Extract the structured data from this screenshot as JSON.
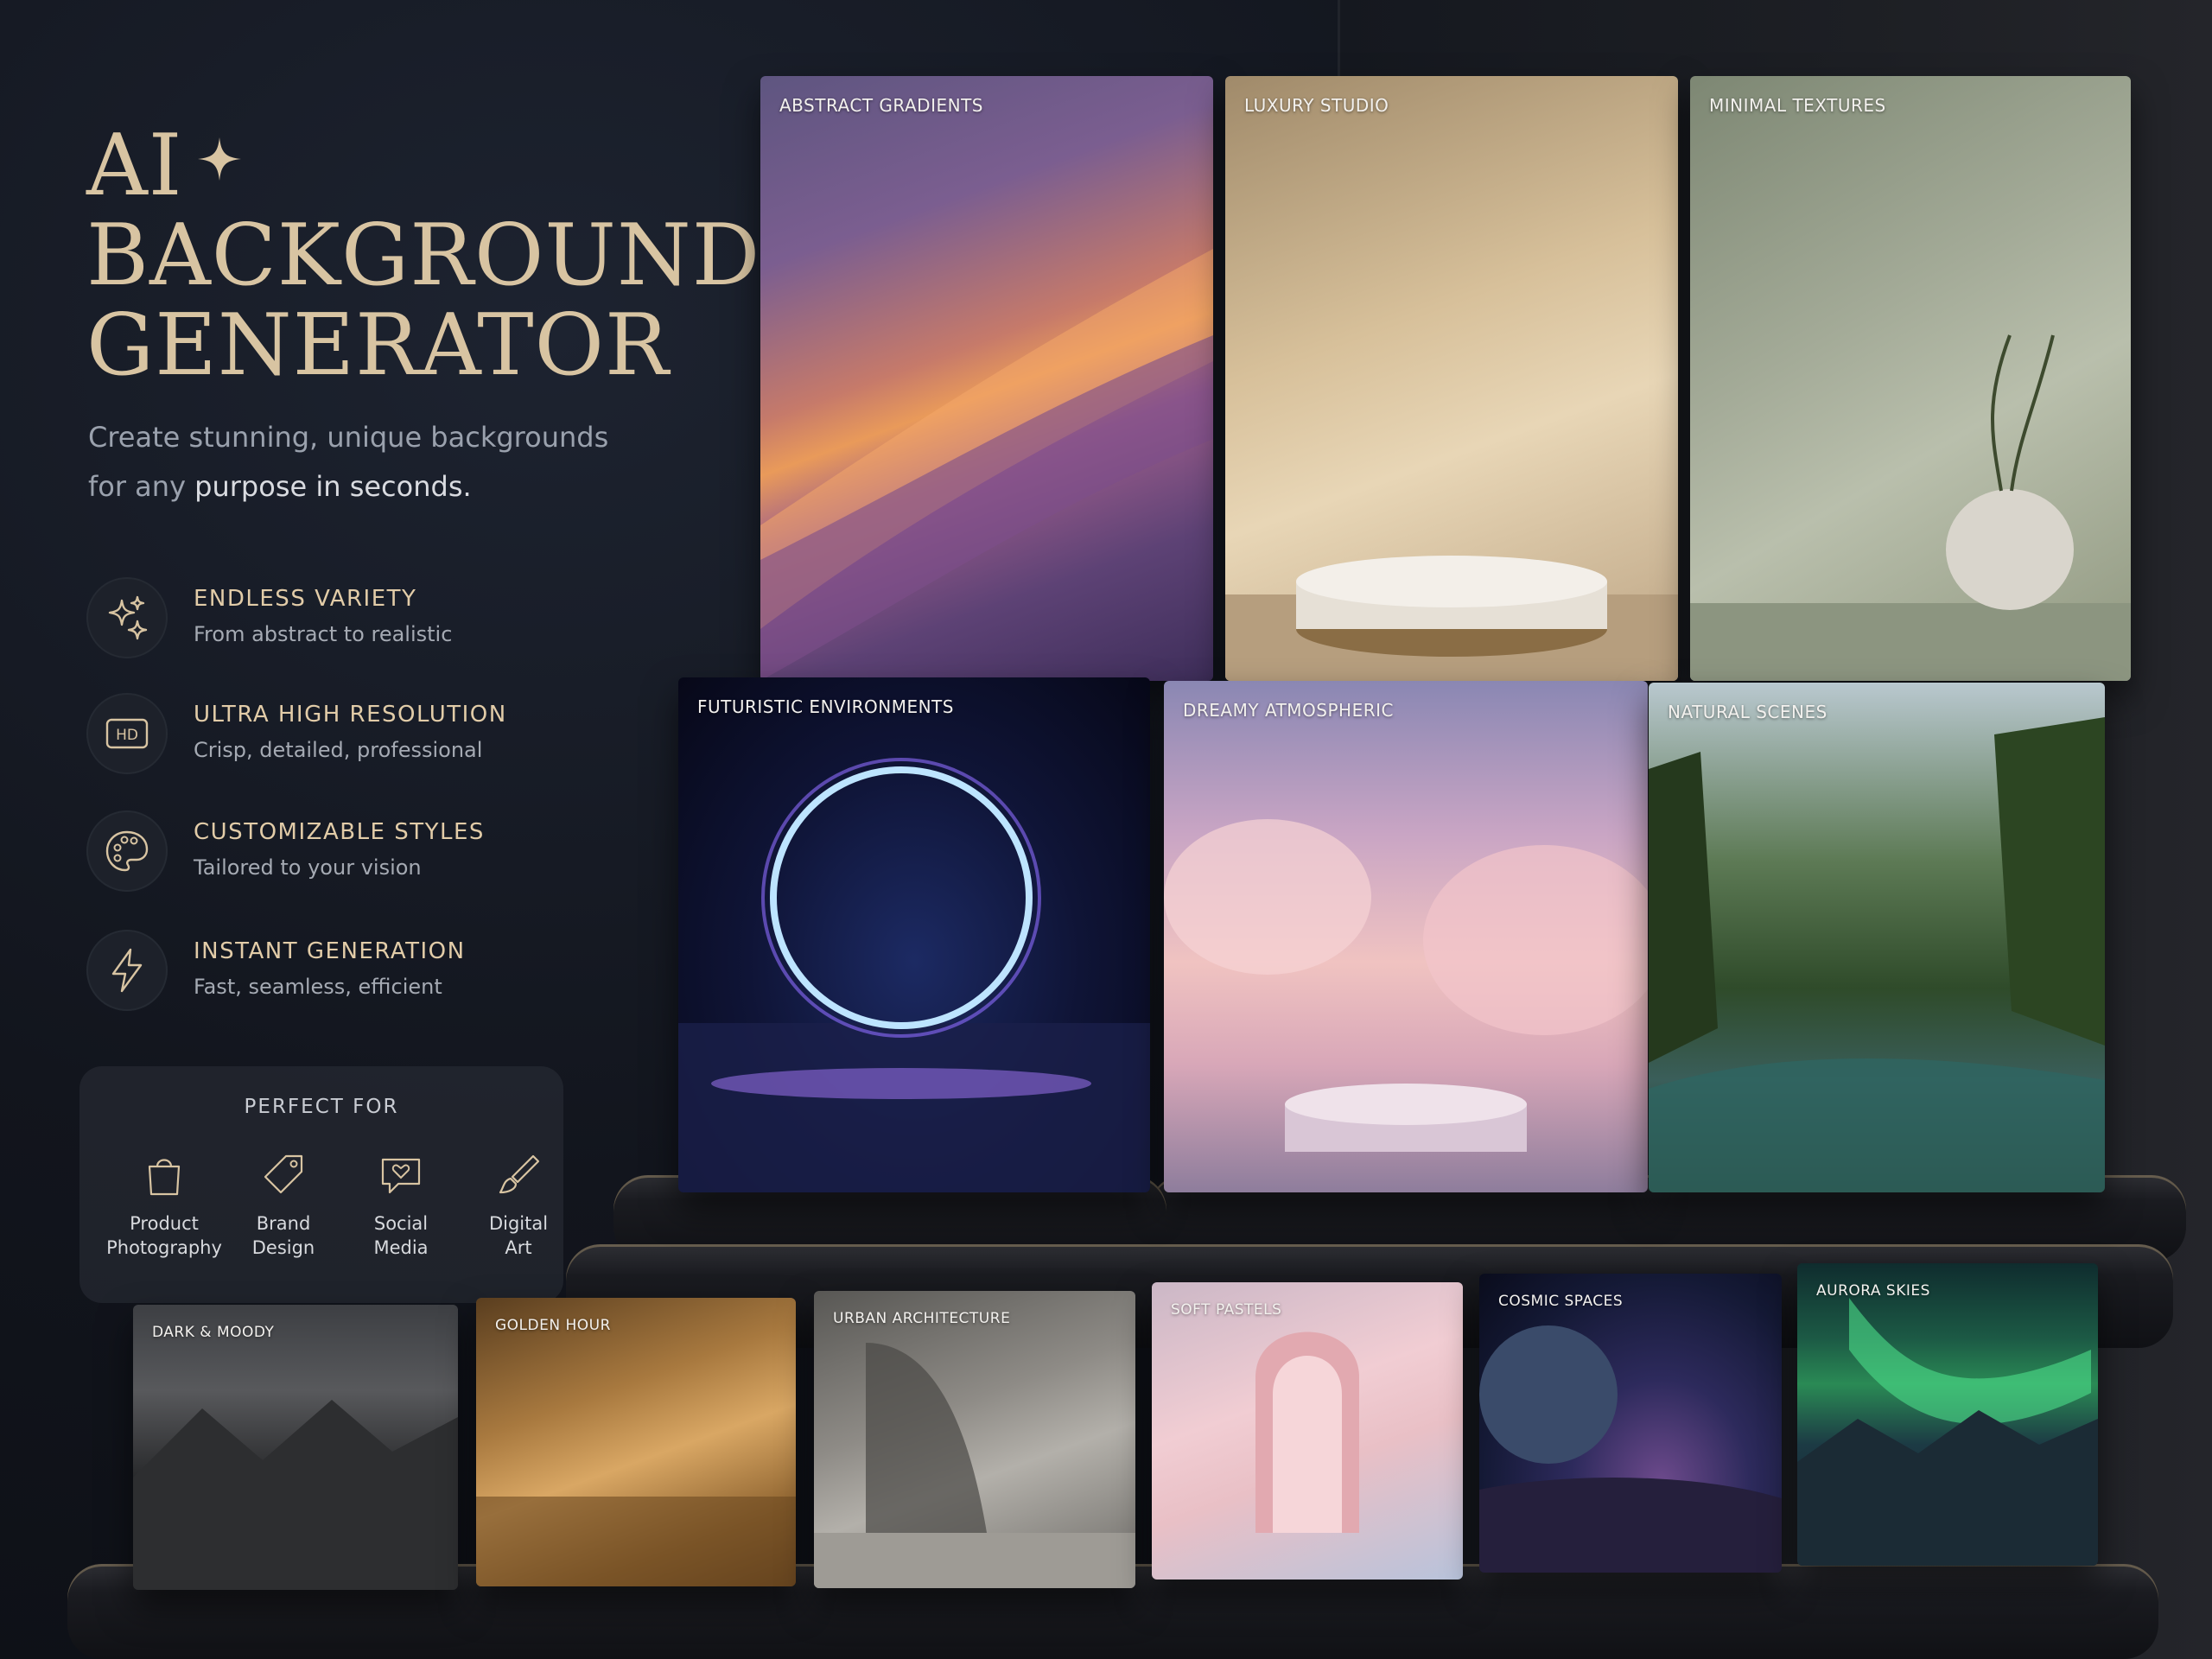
{
  "hero": {
    "title_line1": "AI",
    "title_line2": "BACKGROUND",
    "title_line3": "GENERATOR",
    "subtitle_line1": "Create stunning, unique backgrounds",
    "subtitle_line2_start": "for any ",
    "subtitle_line2_end": "purpose in seconds."
  },
  "features": [
    {
      "title": "ENDLESS VARIETY",
      "desc": "From abstract to realistic",
      "icon": "sparkles-icon"
    },
    {
      "title": "ULTRA HIGH RESOLUTION",
      "desc": "Crisp, detailed, professional",
      "icon": "hd-icon"
    },
    {
      "title": "CUSTOMIZABLE STYLES",
      "desc": "Tailored to your vision",
      "icon": "palette-icon"
    },
    {
      "title": "INSTANT GENERATION",
      "desc": "Fast, seamless, efficient",
      "icon": "lightning-icon"
    }
  ],
  "perfect_for": {
    "heading": "PERFECT FOR",
    "items": [
      {
        "line1": "Product",
        "line2": "Photography",
        "icon": "shopping-bag-icon"
      },
      {
        "line1": "Brand",
        "line2": "Design",
        "icon": "tag-icon"
      },
      {
        "line1": "Social",
        "line2": "Media",
        "icon": "chat-heart-icon"
      },
      {
        "line1": "Digital",
        "line2": "Art",
        "icon": "brush-icon"
      }
    ]
  },
  "gallery": {
    "top": [
      "ABSTRACT GRADIENTS",
      "LUXURY STUDIO",
      "MINIMAL TEXTURES"
    ],
    "middle": [
      "FUTURISTIC ENVIRONMENTS",
      "DREAMY ATMOSPHERIC",
      "NATURAL SCENES"
    ],
    "bottom": [
      "DARK & MOODY",
      "GOLDEN HOUR",
      "URBAN ARCHITECTURE",
      "SOFT PASTELS",
      "COSMIC SPACES",
      "AURORA SKIES"
    ]
  },
  "colors": {
    "accent_gold": "#d8c4a2",
    "background": "#12151d"
  }
}
